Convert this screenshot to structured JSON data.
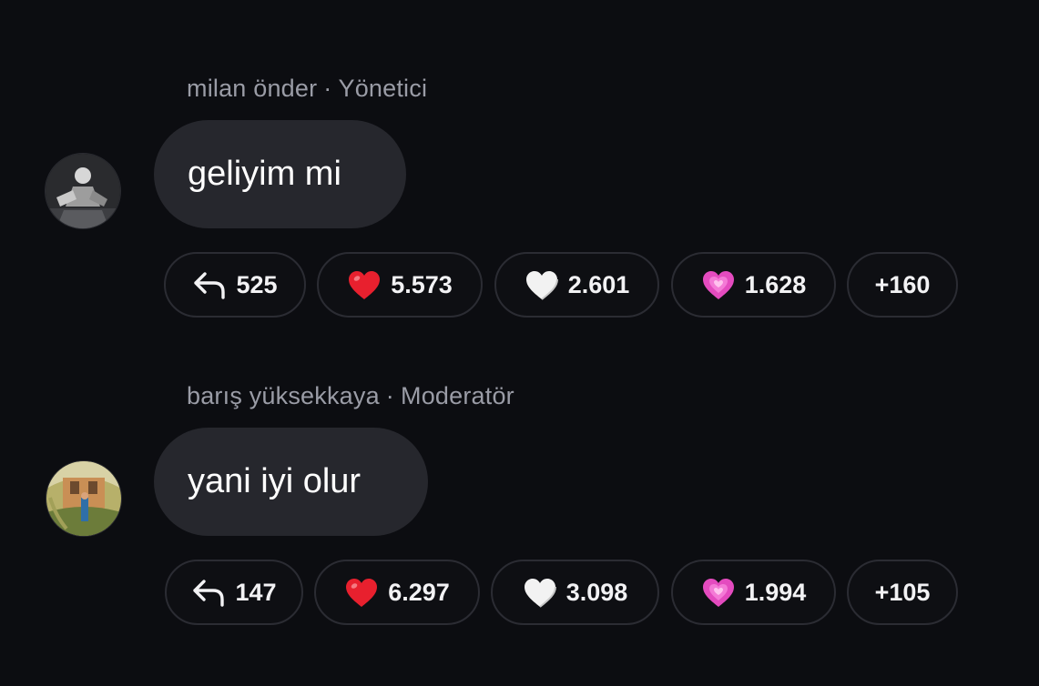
{
  "messages": [
    {
      "author": "milan önder",
      "separator": "·",
      "role": "Yönetici",
      "text": "geliyim mi",
      "reactions": {
        "reply_count": "525",
        "red_heart_count": "5.573",
        "white_heart_count": "2.601",
        "pink_heart_count": "1.628",
        "more_count": "+160"
      }
    },
    {
      "author": "barış yüksekkaya",
      "separator": "·",
      "role": "Moderatör",
      "text": "yani iyi olur",
      "reactions": {
        "reply_count": "147",
        "red_heart_count": "6.297",
        "white_heart_count": "3.098",
        "pink_heart_count": "1.994",
        "more_count": "+105"
      }
    }
  ],
  "icons": {
    "reply": "reply-arrow-icon",
    "red_heart": "red-heart-icon",
    "white_heart": "white-heart-icon",
    "pink_heart": "sparkling-heart-icon"
  },
  "colors": {
    "background": "#0c0d11",
    "bubble": "#26272d",
    "pill_border": "#2b2c33",
    "meta_text": "#9a9ca6",
    "red_heart": "#e8202e",
    "white_heart": "#f2f2f2",
    "pink_heart": "#e44bbf"
  }
}
